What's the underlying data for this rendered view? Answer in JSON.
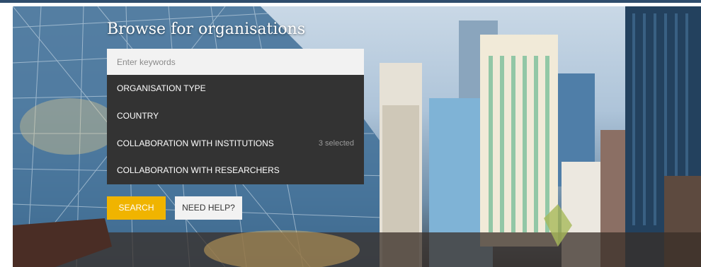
{
  "hero": {
    "title": "Browse for organisations",
    "search": {
      "placeholder": "Enter keywords",
      "value": ""
    },
    "filters": [
      {
        "label": "ORGANISATION TYPE",
        "count": ""
      },
      {
        "label": "COUNTRY",
        "count": ""
      },
      {
        "label": "COLLABORATION WITH INSTITUTIONS",
        "count": "3 selected"
      },
      {
        "label": "COLLABORATION WITH RESEARCHERS",
        "count": ""
      }
    ],
    "search_label": "SEARCH",
    "help_label": "NEED HELP?"
  },
  "colors": {
    "accent": "#f0b400",
    "panel": "#333333",
    "input_bg": "#f2f2f2",
    "top_rule": "#2f4d6d"
  }
}
